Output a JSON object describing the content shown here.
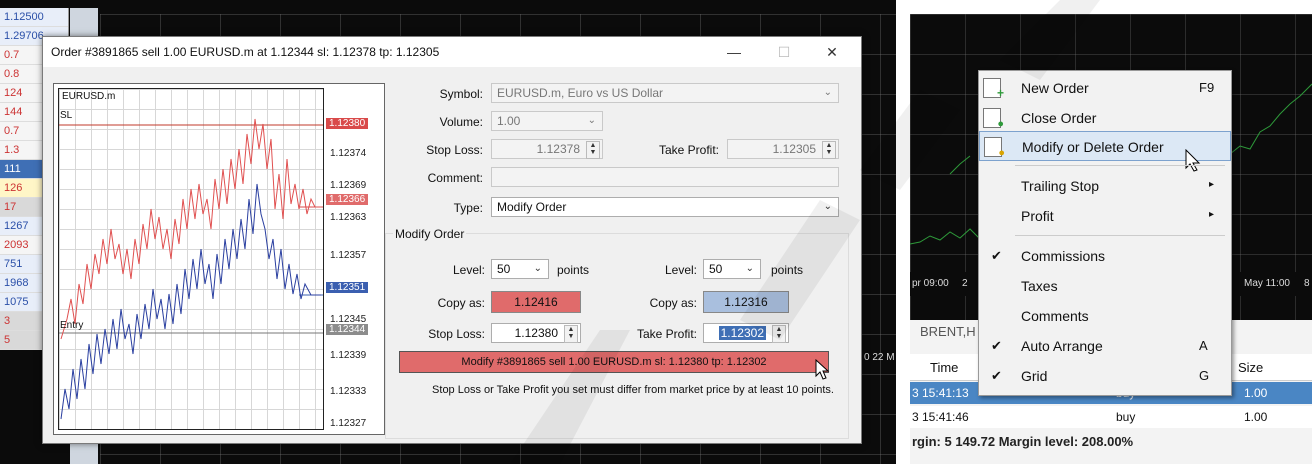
{
  "market_watch": {
    "prices": [
      "1.12500",
      "1.29706",
      "0.7",
      "0.8",
      "124",
      "144",
      "0.7",
      "1.3",
      "111",
      "126",
      "17",
      "1267",
      "2093",
      "751",
      "1968",
      "1075",
      "3",
      "5"
    ]
  },
  "dialog": {
    "title": "Order #3891865 sell 1.00 EURUSD.m at 1.12344 sl: 1.12378 tp: 1.12305",
    "minimize": "—",
    "maximize": "☐",
    "close": "✕",
    "chart": {
      "symbol": "EURUSD.m",
      "sl_label": "SL",
      "entry_label": "Entry",
      "price_labels": [
        "1.12374",
        "1.12369",
        "1.12363",
        "1.12357",
        "1.12345",
        "1.12339",
        "1.12333",
        "1.12327"
      ],
      "price_badges": {
        "sl": "1.12380",
        "ask": "1.12366",
        "bid": "1.12351",
        "entry": "1.12344"
      },
      "badge_colors": {
        "sl": "#d94a4a",
        "ask": "#e06b6b",
        "bid": "#3b5fb0",
        "entry": "#8c8c8c"
      }
    },
    "form": {
      "symbol_label": "Symbol:",
      "symbol_value": "EURUSD.m, Euro vs US Dollar",
      "volume_label": "Volume:",
      "volume_value": "1.00",
      "stop_loss_label": "Stop Loss:",
      "stop_loss_value": "1.12378",
      "take_profit_label": "Take Profit:",
      "take_profit_value": "1.12305",
      "comment_label": "Comment:",
      "comment_value": "",
      "type_label": "Type:",
      "type_value": "Modify Order"
    },
    "modify": {
      "group_label": "Modify Order",
      "level_label": "Level:",
      "level_left": "50",
      "level_right": "50",
      "points": "points",
      "copy_as_label": "Copy as:",
      "copy_left": "1.12416",
      "copy_right": "1.12316",
      "stop_loss_label": "Stop Loss:",
      "stop_loss_value": "1.12380",
      "take_profit_label": "Take Profit:",
      "take_profit_value": "1.12302",
      "button": "Modify #3891865 sell 1.00 EURUSD.m sl: 1.12380 tp: 1.12302",
      "note": "Stop Loss or Take Profit you set must differ from market price by at least 10 points."
    }
  },
  "right": {
    "axis_left": "pr 09:00",
    "axis_mid": "2",
    "axis_right": "May 11:00",
    "axis_far": "8",
    "mid_label": "0 22 M",
    "tab": "BRENT,H",
    "headers": {
      "time": "Time",
      "size": "Size"
    },
    "rows": [
      {
        "time": "3 15:41:13",
        "type": "buy",
        "size": "1.00"
      },
      {
        "time": "3 15:41:46",
        "type": "buy",
        "size": "1.00"
      }
    ],
    "footer": "rgin: 5 149.72  Margin level: 208.00%"
  },
  "context_menu": {
    "new_order": "New Order",
    "new_order_shortcut": "F9",
    "close_order": "Close Order",
    "modify_order": "Modify or Delete Order",
    "trailing_stop": "Trailing Stop",
    "profit": "Profit",
    "commissions": "Commissions",
    "taxes": "Taxes",
    "comments": "Comments",
    "auto_arrange": "Auto Arrange",
    "auto_arrange_shortcut": "A",
    "grid": "Grid",
    "grid_shortcut": "G",
    "check": "✔",
    "arrow": "▸"
  },
  "colors": {
    "sell_red": "#e06b6b",
    "buy_blue": "#3b5fb0",
    "highlight": "#4a86c4"
  }
}
